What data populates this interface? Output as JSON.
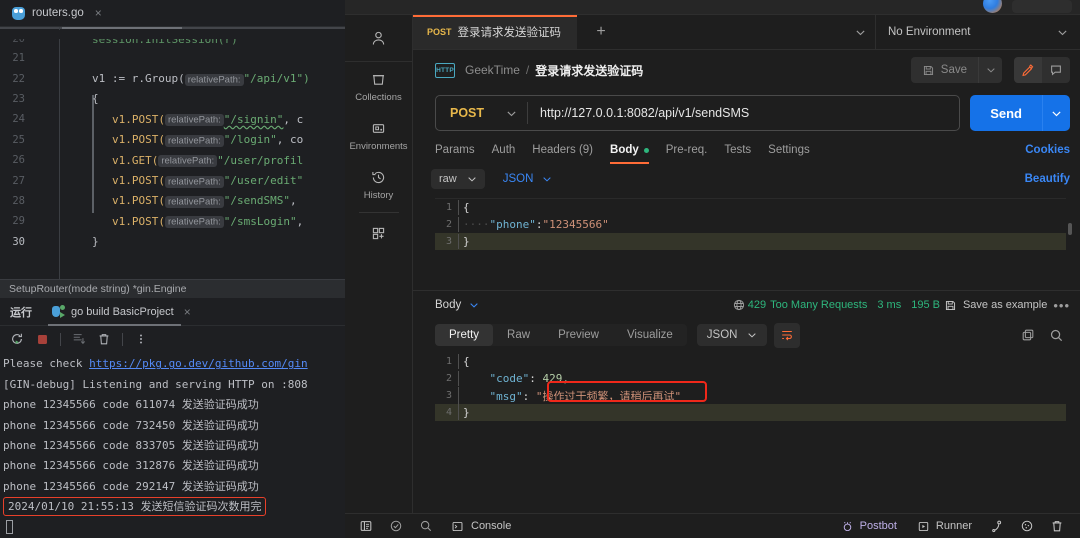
{
  "ide": {
    "file_tab": {
      "name": "routers.go",
      "close": "×",
      "icon": "go-gopher-icon"
    },
    "breadcrumb": "SetupRouter(mode string) *gin.Engine",
    "code_lines": [
      {
        "num": "20",
        "segments": [
          {
            "t": "plain",
            "v": "        "
          },
          {
            "t": "plain",
            "v": "session.InitSession(r)"
          }
        ]
      },
      {
        "num": "21",
        "segments": []
      },
      {
        "num": "22",
        "segments": []
      },
      {
        "num": "23",
        "segments": []
      },
      {
        "num": "24",
        "segments": []
      },
      {
        "num": "25",
        "segments": []
      },
      {
        "num": "26",
        "segments": []
      },
      {
        "num": "27",
        "segments": []
      },
      {
        "num": "28",
        "segments": []
      },
      {
        "num": "29",
        "segments": []
      },
      {
        "num": "30",
        "segments": []
      }
    ],
    "code_text": {
      "l20": "session.InitSession(r)",
      "l22_a": "v1 := r.Group(",
      "l22_hint": "relativePath:",
      "l22_b": "\"/api/v1\")",
      "l23": "{",
      "l24_call": "v1.POST(",
      "l24_hint": "relativePath:",
      "l24_str": "\"/signin\"",
      "l24_tail": ", c",
      "l25_call": "v1.POST(",
      "l25_hint": "relativePath:",
      "l25_str": "\"/login\"",
      "l25_tail": ", co",
      "l26_call": "v1.GET(",
      "l26_hint": "relativePath:",
      "l26_str": "\"/user/profil",
      "l27_call": "v1.POST(",
      "l27_hint": "relativePath:",
      "l27_str": "\"/user/edit\"",
      "l28_call": "v1.POST(",
      "l28_hint": "relativePath:",
      "l28_str": "\"/sendSMS\"",
      "l28_tail": ",",
      "l29_call": "v1.POST(",
      "l29_hint": "relativePath:",
      "l29_str": "\"/smsLogin\"",
      "l29_tail": ",",
      "l30": "}"
    },
    "run_panel": {
      "label": "运行",
      "tab": "go build BasicProject",
      "tab_close": "×",
      "toolbar": [
        "rerun-icon",
        "stop-icon",
        "scroll-to-end-icon",
        "trash-icon",
        "more-icon"
      ]
    },
    "console_lines": [
      {
        "pre": "Please check ",
        "link": "https://pkg.go.dev/github.com/gin",
        "post": ""
      },
      {
        "pre": "[GIN-debug] Listening and serving HTTP on :808",
        "link": "",
        "post": ""
      },
      {
        "pre": "phone 12345566 code 611074 发送验证码成功",
        "link": "",
        "post": ""
      },
      {
        "pre": "phone 12345566 code 732450 发送验证码成功",
        "link": "",
        "post": ""
      },
      {
        "pre": "phone 12345566 code 833705 发送验证码成功",
        "link": "",
        "post": ""
      },
      {
        "pre": "phone 12345566 code 312876 发送验证码成功",
        "link": "",
        "post": ""
      },
      {
        "pre": "phone 12345566 code 292147 发送验证码成功",
        "link": "",
        "post": ""
      }
    ],
    "console_highlight": "2024/01/10 21:55:13 发送短信验证码次数用完"
  },
  "postman": {
    "rail": [
      {
        "label": "",
        "icon": "user-avatar-icon"
      },
      {
        "label": "Collections",
        "icon": "collections-icon"
      },
      {
        "label": "Environments",
        "icon": "environments-icon"
      },
      {
        "label": "History",
        "icon": "history-icon"
      },
      {
        "label": "",
        "icon": "new-workspace-icon"
      }
    ],
    "tab": {
      "method": "POST",
      "title": "登录请求发送验证码"
    },
    "new_tab": "+",
    "environment": "No Environment",
    "breadcrumb": {
      "protocol_badge": "HTTP",
      "collection": "GeekTime",
      "separator": "/",
      "request": "登录请求发送验证码"
    },
    "save": {
      "label": "Save",
      "icon": "floppy-disk-icon"
    },
    "right_icons": [
      "edit-pencil-icon",
      "comment-icon"
    ],
    "request": {
      "method": "POST",
      "url": "http://127.0.0.1:8082/api/v1/sendSMS",
      "send_label": "Send"
    },
    "request_tabs": [
      {
        "label": "Params",
        "active": false
      },
      {
        "label": "Auth",
        "active": false
      },
      {
        "label": "Headers (9)",
        "active": false
      },
      {
        "label": "Body",
        "active": true
      },
      {
        "label": "Pre-req.",
        "active": false
      },
      {
        "label": "Tests",
        "active": false
      },
      {
        "label": "Settings",
        "active": false
      }
    ],
    "cookies_link": "Cookies",
    "body_options": {
      "mode": "raw",
      "format": "JSON",
      "beautify": "Beautify"
    },
    "request_body": [
      {
        "num": "1",
        "code": "{"
      },
      {
        "num": "2",
        "code": "    \"phone\":\"12345566\""
      },
      {
        "num": "3",
        "code": "}"
      }
    ],
    "request_body_parts": {
      "line2_key": "\"phone\"",
      "line2_colon": ":",
      "line2_val": "\"12345566\""
    },
    "response": {
      "body_label": "Body",
      "status_code": "429",
      "status_text": "Too Many Requests",
      "time": "3 ms",
      "size": "195 B",
      "save_example": "Save as example",
      "more": "•••",
      "view_tabs": [
        "Pretty",
        "Raw",
        "Preview",
        "Visualize"
      ],
      "active_view": "Pretty",
      "format": "JSON",
      "lines": [
        {
          "num": "1",
          "code": "{"
        },
        {
          "num": "2",
          "key": "\"code\"",
          "colon": ":",
          "value": "429,",
          "highlight": false
        },
        {
          "num": "3",
          "key": "\"msg\"",
          "colon": ":",
          "value": "\"操作过于频繁，请稍后再试\"",
          "highlight": true
        },
        {
          "num": "4",
          "code": "}"
        }
      ]
    },
    "footer": {
      "left_icons": [
        "sidebar-toggle-icon",
        "check-circle-icon",
        "search-icon"
      ],
      "console": "Console",
      "postbot": "Postbot",
      "runner": "Runner",
      "right_icons": [
        "capture-icon",
        "cookies-icon",
        "trash-icon"
      ]
    },
    "colors": {
      "accent_orange": "#ff6c37",
      "send_blue": "#1572e8",
      "status_green": "#2eb67d",
      "method_yellow": "#e8b84b",
      "link_blue": "#3a87f5",
      "highlight_red": "#f0281a"
    }
  }
}
